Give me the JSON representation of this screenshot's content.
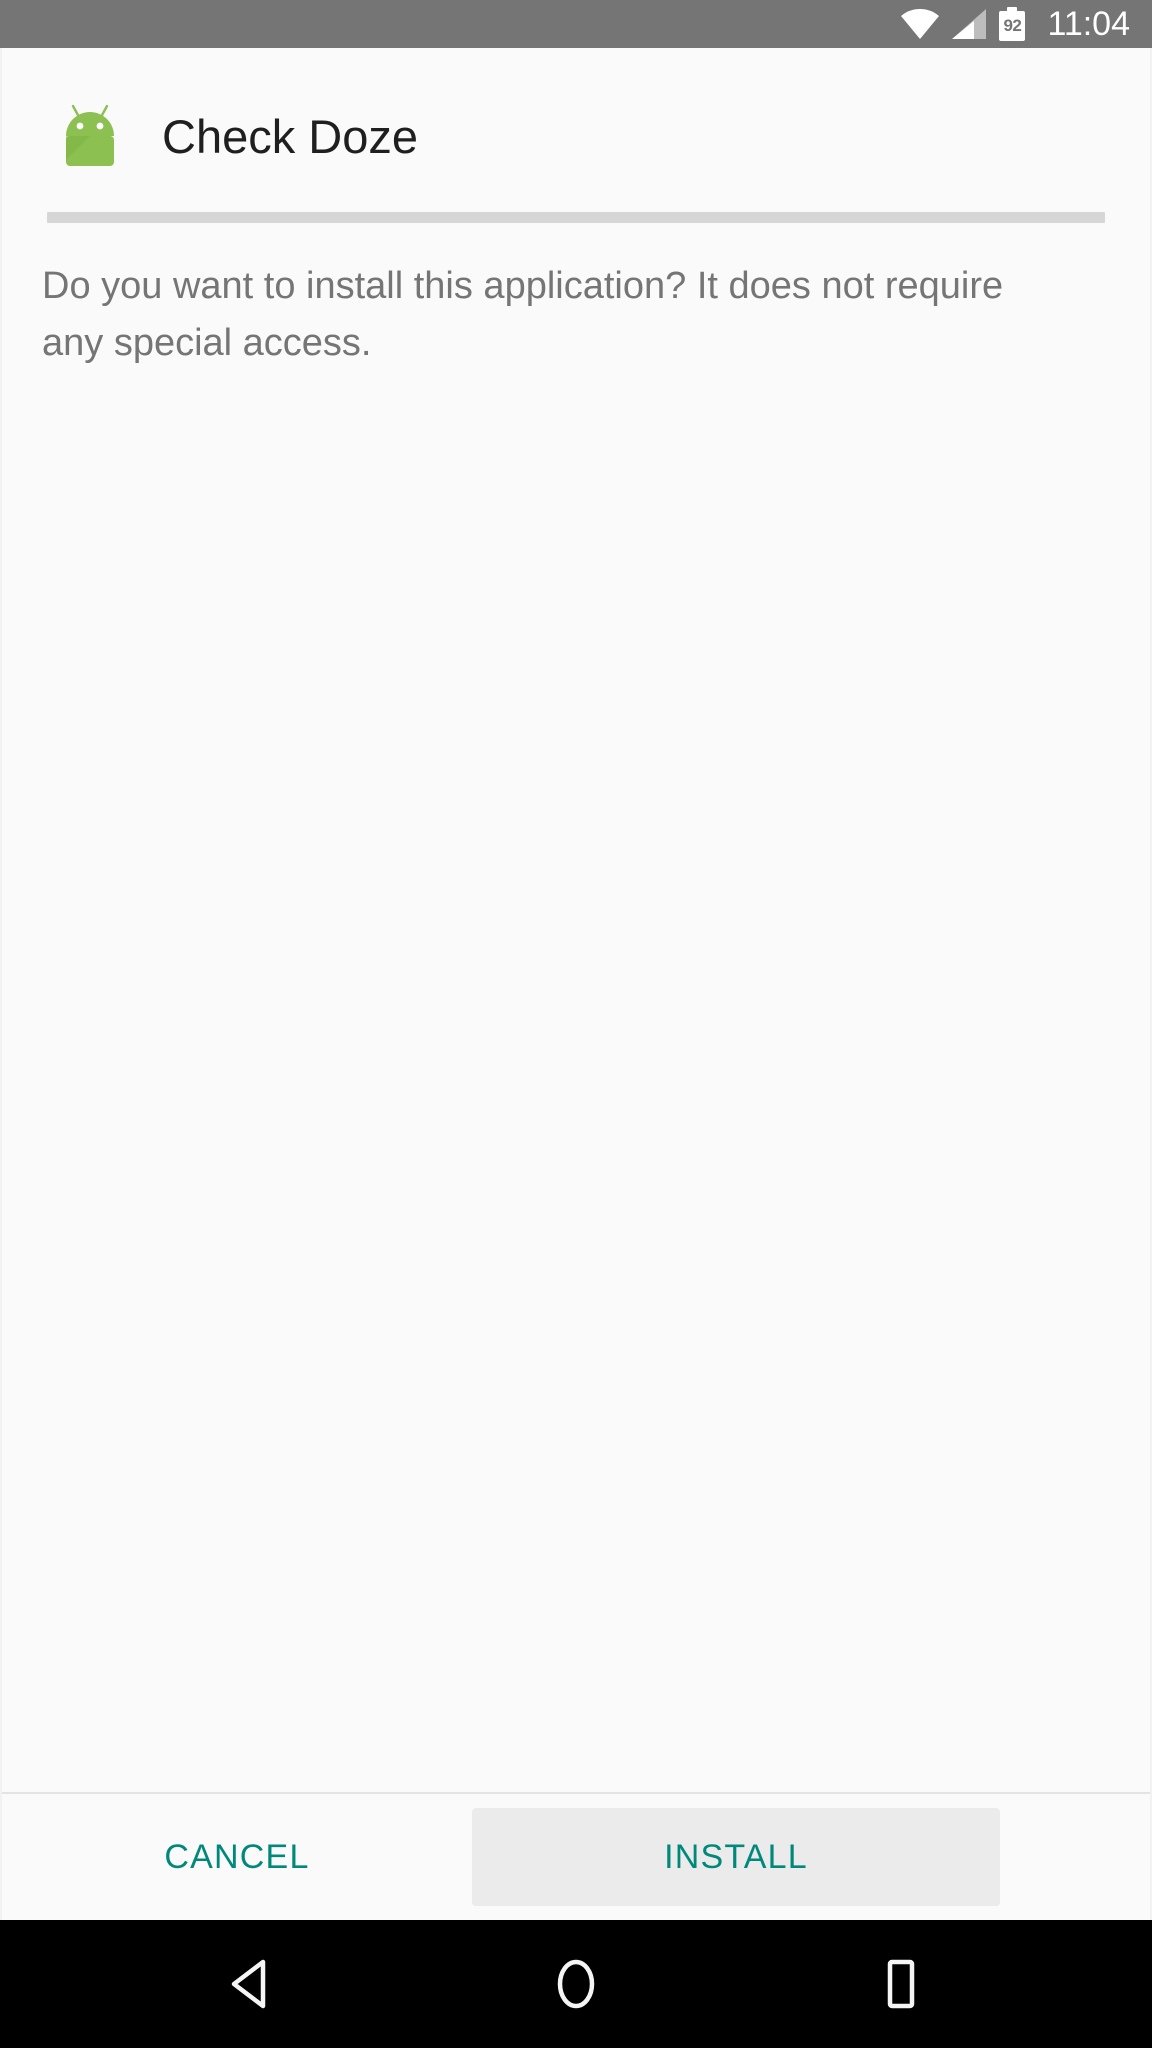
{
  "status_bar": {
    "background_color": "#757575",
    "icons": [
      {
        "name": "wifi-icon",
        "label": "Wi-Fi signal full"
      },
      {
        "name": "cellular-signal-icon",
        "label": "Cellular signal"
      },
      {
        "name": "battery-icon",
        "label": "Battery"
      }
    ],
    "battery_level": "92",
    "time": "11:04"
  },
  "dialog": {
    "app_icon_name": "android-robot-icon",
    "title": "Check Doze",
    "description": "Do you want to install this application? It does not require any special access.",
    "accent_color": "#00897b",
    "background_color": "#fafafa"
  },
  "buttons": {
    "cancel_label": "CANCEL",
    "install_label": "INSTALL"
  },
  "navigation_bar": {
    "background_color": "#000000",
    "items": [
      {
        "name": "nav-back-button",
        "label": "Back"
      },
      {
        "name": "nav-home-button",
        "label": "Home"
      },
      {
        "name": "nav-recents-button",
        "label": "Recent apps"
      }
    ]
  }
}
